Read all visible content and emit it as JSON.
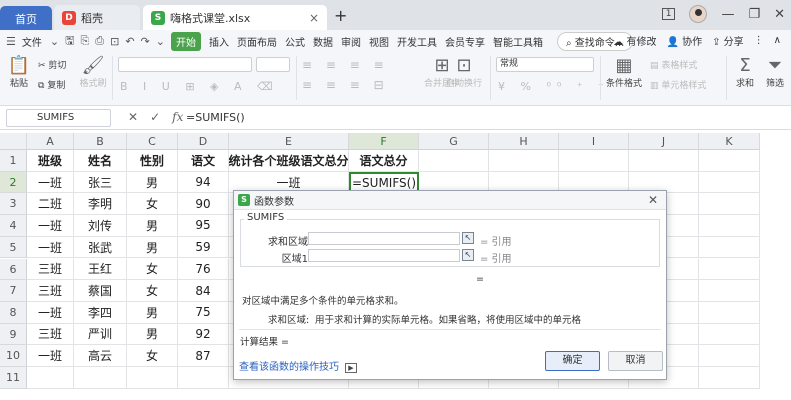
{
  "tabs": [
    {
      "label": "首页"
    },
    {
      "label": "稻壳",
      "logo": "D"
    },
    {
      "label": "嗨格式课堂.xlsx",
      "logo": "S"
    }
  ],
  "tab_close": "×",
  "tab_add": "+",
  "window": {
    "badge": "1",
    "minimize": "—",
    "restore": "❐",
    "close": "✕"
  },
  "menu": {
    "file": "文件",
    "items": [
      "开始",
      "插入",
      "页面布局",
      "公式",
      "数据",
      "审阅",
      "视图",
      "开发工具",
      "会员专享",
      "智能工具箱"
    ],
    "search": "查找命令...",
    "right": [
      "有修改",
      "协作",
      "分享"
    ]
  },
  "ribbon": {
    "paste": "粘贴",
    "cut": "剪切",
    "copy": "复制",
    "format_painter": "格式刷",
    "merge": "合并居中",
    "wrap": "自动换行",
    "number_format": "常规",
    "conditional": "条件格式",
    "table_style": "表格样式",
    "cell_style": "单元格样式",
    "sum": "求和",
    "filter": "筛选"
  },
  "formula_bar": {
    "name_box": "SUMIFS",
    "cancel": "✕",
    "confirm": "✓",
    "fx": "fx",
    "formula": "=SUMIFS()"
  },
  "grid": {
    "columns": [
      "A",
      "B",
      "C",
      "D",
      "E",
      "F",
      "G",
      "H",
      "I",
      "J",
      "K"
    ],
    "rows": [
      "1",
      "2",
      "3",
      "4",
      "5",
      "6",
      "7",
      "8",
      "9",
      "10",
      "11"
    ],
    "cells": [
      [
        "班级",
        "姓名",
        "性别",
        "语文",
        "统计各个班级语文总分",
        "语文总分"
      ],
      [
        "一班",
        "张三",
        "男",
        "94",
        "一班",
        "=SUMIFS()"
      ],
      [
        "二班",
        "李明",
        "女",
        "90",
        "",
        ""
      ],
      [
        "一班",
        "刘传",
        "男",
        "95",
        "",
        ""
      ],
      [
        "一班",
        "张武",
        "男",
        "59",
        "",
        ""
      ],
      [
        "三班",
        "王红",
        "女",
        "76",
        "",
        ""
      ],
      [
        "三班",
        "蔡国",
        "女",
        "84",
        "",
        ""
      ],
      [
        "一班",
        "李四",
        "男",
        "75",
        "",
        ""
      ],
      [
        "三班",
        "严训",
        "男",
        "92",
        "",
        ""
      ],
      [
        "一班",
        "高云",
        "女",
        "87",
        "",
        ""
      ],
      [
        "",
        "",
        "",
        "",
        "",
        ""
      ]
    ]
  },
  "dialog": {
    "title": "函数参数",
    "close": "✕",
    "function_name": "SUMIFS",
    "args": [
      {
        "label": "求和区域",
        "ref": "= 引用"
      },
      {
        "label": "区域1",
        "ref": "= 引用"
      }
    ],
    "result_eq": "=",
    "description": "对区域中满足多个条件的单元格求和。",
    "arg_help_label": "求和区域:",
    "arg_help": "用于求和计算的实际单元格。如果省略，将使用区域中的单元格",
    "calc_result": "计算结果 =",
    "link": "查看该函数的操作技巧",
    "ok": "确定",
    "cancel": "取消"
  }
}
